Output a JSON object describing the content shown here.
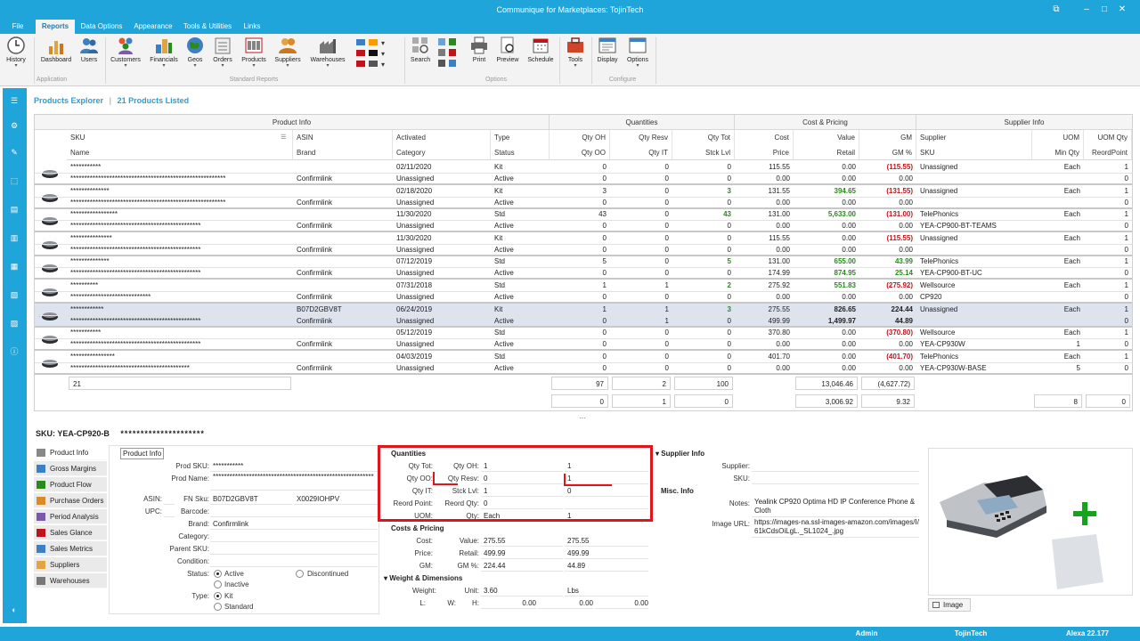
{
  "window": {
    "title": "Communique for Marketplaces: TojinTech"
  },
  "menu": {
    "file": "File",
    "tabs": [
      "Reports",
      "Data Options",
      "Appearance",
      "Tools & Utilities",
      "Links"
    ]
  },
  "ribbon": {
    "buttons": [
      "History",
      "Dashboard",
      "Users",
      "Customers",
      "Financials",
      "Geos",
      "Orders",
      "Products",
      "Suppliers",
      "Warehouses",
      "Search",
      "Print",
      "Preview",
      "Schedule",
      "Tools",
      "Display",
      "Options"
    ],
    "groups": [
      "Application",
      "Standard Reports",
      "Options",
      "Configure"
    ]
  },
  "explorer": {
    "title": "Products Explorer",
    "count": "21 Products Listed"
  },
  "grid": {
    "bands": [
      "Product Info",
      "Quantities",
      "Cost & Pricing",
      "Supplier Info"
    ],
    "header1": [
      "SKU",
      "ASIN",
      "Activated",
      "Type",
      "Qty OH",
      "Qty Resv",
      "Qty Tot",
      "Cost",
      "Value",
      "GM",
      "Supplier",
      "UOM",
      "UOM Qty"
    ],
    "header2": [
      "Name",
      "Brand",
      "Category",
      "Status",
      "Qty OO",
      "Qty IT",
      "Stck Lvl",
      "Price",
      "Retail",
      "GM %",
      "SKU",
      "Min Qty",
      "ReordPoint"
    ],
    "rows": [
      {
        "sku": "***********",
        "name": "********************************************************",
        "asin": "",
        "brand": "Confirmlink",
        "act": "02/11/2020",
        "cat": "Unassigned",
        "type": "Kit",
        "status": "Active",
        "oh": "0",
        "oo": "0",
        "resv": "0",
        "it": "0",
        "tot": "0",
        "stk": "0",
        "cost": "115.55",
        "price": "0.00",
        "value": "0.00",
        "retail": "0.00",
        "gm": "(115.55)",
        "gmp": "0.00",
        "sup": "Unassigned",
        "ssku": "",
        "uom": "Each",
        "min": "",
        "uq": "1",
        "rp": "0"
      },
      {
        "sku": "**************",
        "name": "********************************************************",
        "asin": "",
        "brand": "Confirmlink",
        "act": "02/18/2020",
        "cat": "Unassigned",
        "type": "Kit",
        "status": "Active",
        "oh": "3",
        "oo": "0",
        "resv": "0",
        "it": "0",
        "tot": "3",
        "stk": "0",
        "cost": "131.55",
        "price": "0.00",
        "value": "394.65",
        "retail": "0.00",
        "gm": "(131.55)",
        "gmp": "0.00",
        "sup": "Unassigned",
        "ssku": "",
        "uom": "Each",
        "min": "",
        "uq": "1",
        "rp": "0"
      },
      {
        "sku": "*****************",
        "name": "***********************************************",
        "asin": "",
        "brand": "Confirmlink",
        "act": "11/30/2020",
        "cat": "Unassigned",
        "type": "Std",
        "status": "Active",
        "oh": "43",
        "oo": "0",
        "resv": "0",
        "it": "0",
        "tot": "43",
        "stk": "0",
        "cost": "131.00",
        "price": "0.00",
        "value": "5,633.00",
        "retail": "0.00",
        "gm": "(131.00)",
        "gmp": "0.00",
        "sup": "TelePhonics",
        "ssku": "YEA-CP900-BT-TEAMS",
        "uom": "Each",
        "min": "",
        "uq": "1",
        "rp": "0"
      },
      {
        "sku": "***************",
        "name": "***********************************************",
        "asin": "",
        "brand": "Confirmlink",
        "act": "11/30/2020",
        "cat": "Unassigned",
        "type": "Kit",
        "status": "Active",
        "oh": "0",
        "oo": "0",
        "resv": "0",
        "it": "0",
        "tot": "0",
        "stk": "0",
        "cost": "115.55",
        "price": "0.00",
        "value": "0.00",
        "retail": "0.00",
        "gm": "(115.55)",
        "gmp": "0.00",
        "sup": "Unassigned",
        "ssku": "",
        "uom": "Each",
        "min": "",
        "uq": "1",
        "rp": "0"
      },
      {
        "sku": "**************",
        "name": "***********************************************",
        "asin": "",
        "brand": "Confirmlink",
        "act": "07/12/2019",
        "cat": "Unassigned",
        "type": "Std",
        "status": "Active",
        "oh": "5",
        "oo": "0",
        "resv": "0",
        "it": "0",
        "tot": "5",
        "stk": "0",
        "cost": "131.00",
        "price": "174.99",
        "value": "655.00",
        "retail": "874.95",
        "gm": "43.99",
        "gmp": "25.14",
        "sup": "TelePhonics",
        "ssku": "YEA-CP900-BT-UC",
        "uom": "Each",
        "min": "",
        "uq": "1",
        "rp": "0"
      },
      {
        "sku": "**********",
        "name": "*****************************",
        "asin": "",
        "brand": "Confirmlink",
        "act": "07/31/2018",
        "cat": "Unassigned",
        "type": "Std",
        "status": "Active",
        "oh": "1",
        "oo": "0",
        "resv": "1",
        "it": "0",
        "tot": "2",
        "stk": "0",
        "cost": "275.92",
        "price": "0.00",
        "value": "551.83",
        "retail": "0.00",
        "gm": "(275.92)",
        "gmp": "0.00",
        "sup": "Wellsource",
        "ssku": "CP920",
        "uom": "Each",
        "min": "",
        "uq": "1",
        "rp": "0"
      },
      {
        "sku": "************",
        "name": "***********************************************",
        "asin": "B07D2GBV8T",
        "brand": "Confirmlink",
        "act": "06/24/2019",
        "cat": "Unassigned",
        "type": "Kit",
        "status": "Active",
        "oh": "1",
        "oo": "0",
        "resv": "1",
        "it": "1",
        "tot": "3",
        "stk": "0",
        "cost": "275.55",
        "price": "499.99",
        "value": "826.65",
        "retail": "1,499.97",
        "gm": "224.44",
        "gmp": "44.89",
        "sup": "Unassigned",
        "ssku": "",
        "uom": "Each",
        "min": "",
        "uq": "1",
        "rp": "0"
      },
      {
        "sku": "***********",
        "name": "***********************************************",
        "asin": "",
        "brand": "Confirmlink",
        "act": "05/12/2019",
        "cat": "Unassigned",
        "type": "Std",
        "status": "Active",
        "oh": "0",
        "oo": "0",
        "resv": "0",
        "it": "0",
        "tot": "0",
        "stk": "0",
        "cost": "370.80",
        "price": "0.00",
        "value": "0.00",
        "retail": "0.00",
        "gm": "(370.80)",
        "gmp": "0.00",
        "sup": "Wellsource",
        "ssku": "YEA-CP930W",
        "uom": "Each",
        "min": "1",
        "uq": "1",
        "rp": "0"
      },
      {
        "sku": "****************",
        "name": "*******************************************",
        "asin": "",
        "brand": "Confirmlink",
        "act": "04/03/2019",
        "cat": "Unassigned",
        "type": "Std",
        "status": "Active",
        "oh": "0",
        "oo": "0",
        "resv": "0",
        "it": "0",
        "tot": "0",
        "stk": "0",
        "cost": "401.70",
        "price": "0.00",
        "value": "0.00",
        "retail": "0.00",
        "gm": "(401.70)",
        "gmp": "0.00",
        "sup": "TelePhonics",
        "ssku": "YEA-CP930W-BASE",
        "uom": "Each",
        "min": "5",
        "uq": "1",
        "rp": "0"
      }
    ],
    "summary": {
      "count": "21",
      "oh": "97",
      "resv": "2",
      "tot": "100",
      "value": "13,046.46",
      "gm": "(4,627.72)",
      "oo": "0",
      "it": "1",
      "stk": "0",
      "retail": "3,006.92",
      "gmp": "9.32",
      "min": "8",
      "rp": "0"
    },
    "ellipsis": "..."
  },
  "detail": {
    "sku_label": "SKU: YEA-CP920-B",
    "sku_mask": "*********************",
    "nav": [
      "Product Info",
      "Gross Margins",
      "Product Flow",
      "Purchase Orders",
      "Period Analysis",
      "Sales Glance",
      "Sales Metrics",
      "Suppliers",
      "Warehouses"
    ],
    "product_info": {
      "header": "Product Info",
      "prod_sku_lbl": "Prod SKU:",
      "prod_sku": "***********",
      "prod_name_lbl": "Prod Name:",
      "prod_name": "**********************************************************",
      "asin_lbl": "ASIN:",
      "fnsku_lbl": "FN Sku:",
      "fnsku": "B07D2GBV8T",
      "fnsku2": "X0029IOHPV",
      "upc_lbl": "UPC:",
      "barcode_lbl": "Barcode:",
      "brand_lbl": "Brand:",
      "brand": "Confirmlink",
      "category_lbl": "Category:",
      "parent_lbl": "Parent SKU:",
      "condition_lbl": "Condition:",
      "status_lbl": "Status:",
      "active": "Active",
      "inactive": "Inactive",
      "discontinued": "Discontinued",
      "type_lbl": "Type:",
      "kit": "Kit",
      "standard": "Standard"
    },
    "quantities": {
      "header": "Quantities",
      "rows": [
        {
          "a": "Qty Tot:",
          "b": "Qty OH:",
          "v1": "1",
          "v2": "1"
        },
        {
          "a": "Qty OO:",
          "b": "Qty Resv:",
          "v1": "0",
          "v2": "1"
        },
        {
          "a": "Qty IT:",
          "b": "Stck Lvl:",
          "v1": "1",
          "v2": "0"
        },
        {
          "a": "Reord Point:",
          "b": "Reord Qty:",
          "v1": "0",
          "v2": ""
        },
        {
          "a": "UOM:",
          "b": "Qty:",
          "v1": "Each",
          "v2": "1"
        }
      ]
    },
    "costs": {
      "header": "Costs & Pricing",
      "rows": [
        {
          "a": "Cost:",
          "b": "Value:",
          "v1": "275.55",
          "v2": "275.55"
        },
        {
          "a": "Price:",
          "b": "Retail:",
          "v1": "499.99",
          "v2": "499.99"
        },
        {
          "a": "GM:",
          "b": "GM %:",
          "v1": "224.44",
          "v2": "44.89"
        }
      ]
    },
    "weight": {
      "header": "Weight & Dimensions",
      "weight_lbl": "Weight:",
      "unit_lbl": "Unit:",
      "unit": "3.60",
      "unit2": "Lbs",
      "l_lbl": "L:",
      "w_lbl": "W:",
      "h_lbl": "H:",
      "h": "0.00",
      "h2": "0.00",
      "h3": "0.00"
    },
    "supplier": {
      "header": "Supplier Info",
      "supplier_lbl": "Supplier:",
      "sku_lbl": "SKU:"
    },
    "misc": {
      "header": "Misc. Info",
      "notes_lbl": "Notes:",
      "notes": "Yealink CP920 Optima HD IP Conference Phone & Cloth",
      "url_lbl": "Image URL:",
      "url": "https://images-na.ssl-images-amazon.com/images/I/61kCdsOiLgL._SL1024_.jpg"
    },
    "image_btn": "Image"
  },
  "status": {
    "user": "Admin",
    "company": "TojinTech",
    "version": "Alexa 22.177"
  },
  "colors": {
    "accent": "#1fa5d9",
    "negative": "#c0141c",
    "positive": "#2b8a1e",
    "highlight": "#e0141c"
  }
}
